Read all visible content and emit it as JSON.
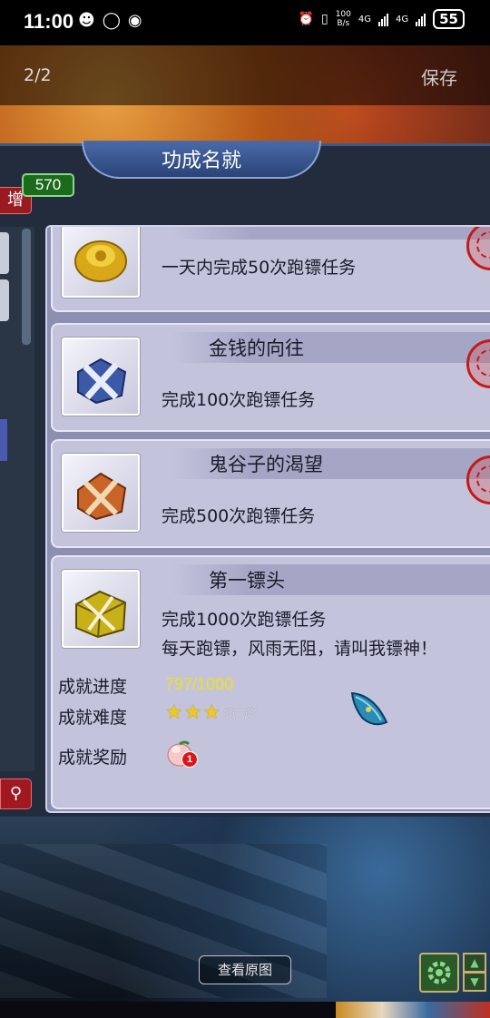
{
  "status_bar": {
    "time": "11:00",
    "net_speed_top": "100",
    "net_speed_bottom": "B/s",
    "sim1": "4G",
    "sim2": "4G",
    "battery": "55"
  },
  "viewer": {
    "page_counter": "2/2",
    "save_label": "保存",
    "view_original_label": "查看原图"
  },
  "game": {
    "panel_title": "功成名就",
    "score": "570",
    "left_tab_label": "增",
    "search_icon": "search-icon",
    "achievements": [
      {
        "name": "",
        "desc": "一天内完成50次跑镖任务",
        "icon": "gold-ingot"
      },
      {
        "name": "金钱的向往",
        "desc": "完成100次跑镖任务",
        "icon": "blue-bundle"
      },
      {
        "name": "鬼谷子的渴望",
        "desc": "完成500次跑镖任务",
        "icon": "orange-bundle"
      },
      {
        "name": "第一镖头",
        "desc": "完成1000次跑镖任务",
        "flavor": "每天跑镖，风雨无阻，请叫我镖神！",
        "icon": "gold-chest"
      }
    ],
    "detail": {
      "progress_label": "成就进度",
      "progress_value": "797/1000",
      "progress_fraction": 0.797,
      "difficulty_label": "成就难度",
      "difficulty_stars": 3,
      "difficulty_max": 5,
      "reward_label": "成就奖励",
      "reward_count": "1"
    },
    "colors": {
      "progress_text": "#f0e020",
      "seal_red": "#c41a1a",
      "score_green": "#1c6a1c"
    }
  }
}
